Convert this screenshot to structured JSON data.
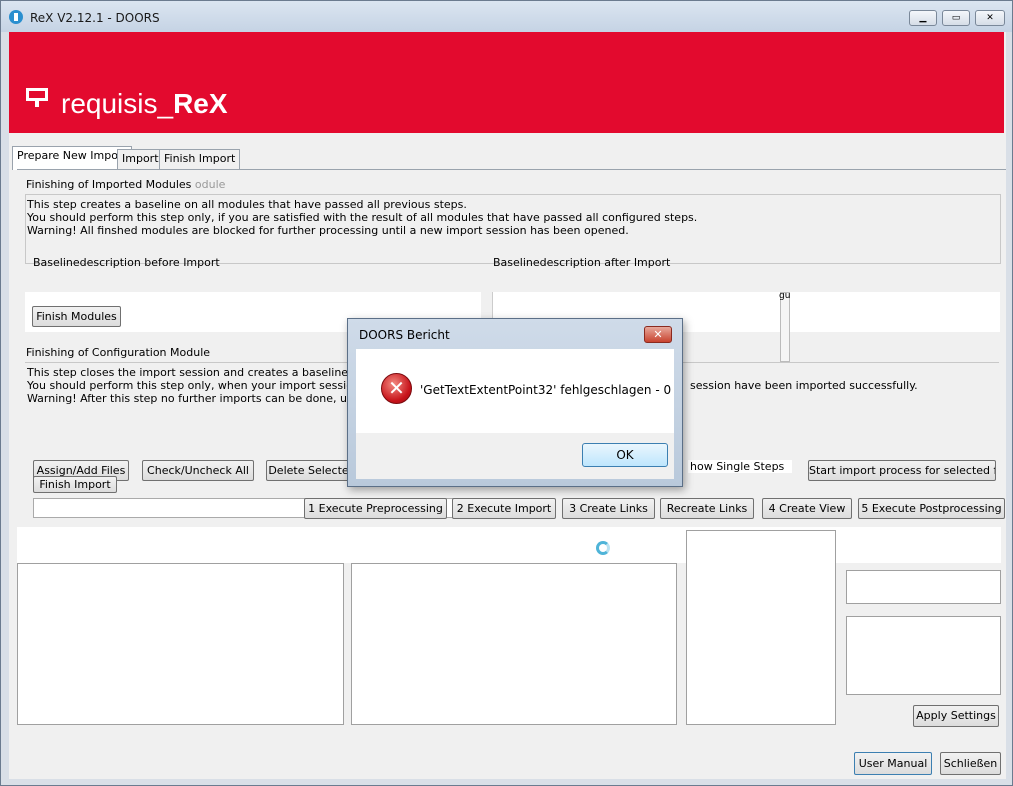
{
  "window": {
    "title": "ReX V2.12.1 - DOORS",
    "minimize_icon": "minimize-icon",
    "maximize_icon": "maximize-icon",
    "close_icon": "close-icon"
  },
  "banner": {
    "logo_prefix": "requisis_",
    "logo_bold": "ReX",
    "background": "#e30a2e"
  },
  "tabs": [
    "Prepare New Import",
    "Import",
    "Finish Import"
  ],
  "active_tab": "Prepare New Import",
  "finishing_modules": {
    "group_title": "Finishing of Imported Modules",
    "ghost_suffix": "odule",
    "description": [
      "This step creates a baseline on all modules that have passed all previous steps.",
      "You should perform this step only, if you are satisfied with the result of all modules that have passed all configured steps.",
      "Warning! All finshed modules are blocked for further processing until a new import session has been opened."
    ],
    "baseline_before_label": "Baselinedescription before Import",
    "baseline_after_label": "Baselinedescription after Import",
    "finish_modules_button": "Finish Modules",
    "ghost_text": "gu"
  },
  "finishing_config": {
    "group_title": "Finishing of Configuration Module",
    "description": [
      "This step closes the import session and creates a baseline on the co",
      "You should perform this step only, when your import session is finishe",
      "Warning! After this step no further imports can be done, until you ope"
    ],
    "description_right": "session have been imported successfully.",
    "finish_import_button": "Finish Import"
  },
  "toolbar": {
    "assign_add_files": "Assign/Add Files",
    "check_uncheck_all": "Check/Uncheck All",
    "delete_selected": "Delete Selected",
    "show_single_steps": "how Single Steps",
    "start_import_selected": "Start import process for selected files"
  },
  "steps": {
    "execute_preprocessing": "1 Execute Preprocessing",
    "execute_import": "2 Execute Import",
    "create_links": "3 Create Links",
    "recreate_links": "Recreate Links",
    "create_view": "4 Create View",
    "execute_postprocessing": "5 Execute Postprocessing"
  },
  "apply_settings": "Apply Settings",
  "footer": {
    "user_manual": "User Manual",
    "close": "Schließen"
  },
  "dialog": {
    "title": "DOORS Bericht",
    "message": "'GetTextExtentPoint32' fehlgeschlagen - 0",
    "ok": "OK",
    "icon": "error-icon"
  }
}
